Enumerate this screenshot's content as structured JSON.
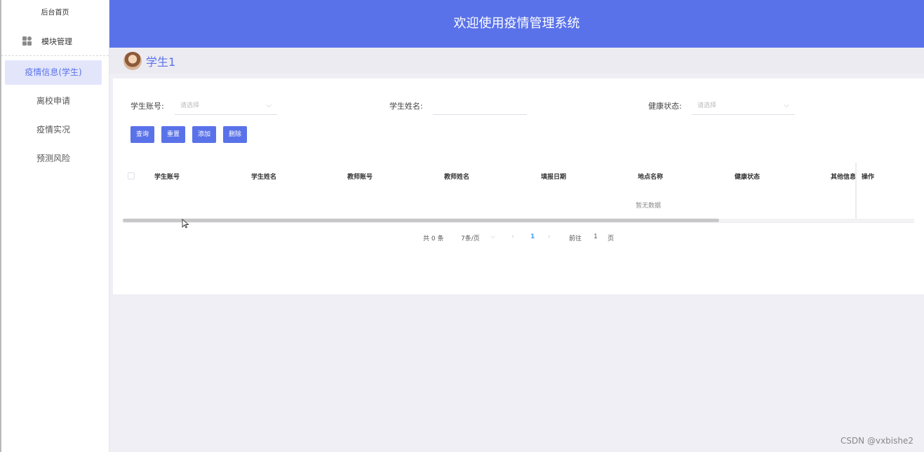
{
  "sidebar": {
    "home": "后台首页",
    "module": "模块管理",
    "items": [
      {
        "label": "疫情信息(学生)",
        "active": true
      },
      {
        "label": "离校申请"
      },
      {
        "label": "疫情实况"
      },
      {
        "label": "预测风险"
      }
    ]
  },
  "header": {
    "title": "欢迎使用疫情管理系统"
  },
  "user": {
    "name": "学生1"
  },
  "filters": {
    "student_account_label": "学生账号:",
    "student_account_placeholder": "请选择",
    "student_name_label": "学生姓名:",
    "student_name_value": "",
    "health_status_label": "健康状态:",
    "health_status_placeholder": "请选择"
  },
  "buttons": {
    "query": "查询",
    "reset": "重置",
    "add": "添加",
    "delete": "删除"
  },
  "table": {
    "columns": [
      "学生账号",
      "学生姓名",
      "教师账号",
      "教师姓名",
      "填报日期",
      "地点名称",
      "健康状态",
      "其他信息",
      "操作"
    ],
    "empty_text": "暂无数据"
  },
  "pagination": {
    "total": "共 0 条",
    "page_size": "7条/页",
    "current_page": "1",
    "goto_label": "前往",
    "goto_value": "1",
    "page_suffix": "页"
  },
  "watermark": "CSDN @vxbishe2",
  "colors": {
    "primary": "#5a72e9",
    "active_bg": "#e3e6fb"
  }
}
